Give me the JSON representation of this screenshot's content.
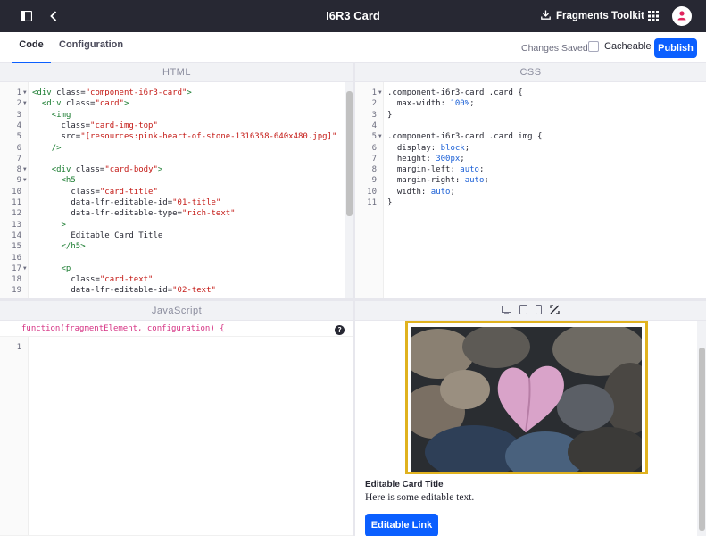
{
  "topbar": {
    "title": "I6R3 Card",
    "toolkit_label": "Fragments Toolkit"
  },
  "subbar": {
    "tabs": [
      {
        "label": "Code"
      },
      {
        "label": "Configuration"
      }
    ],
    "status": "Changes Saved",
    "cacheable_label": "Cacheable",
    "publish_label": "Publish"
  },
  "html_panel": {
    "header": "HTML",
    "lines": [
      {
        "n": "1",
        "fold": true,
        "code": "<div class=\"component-i6r3-card\">"
      },
      {
        "n": "2",
        "fold": true,
        "code": "  <div class=\"card\">"
      },
      {
        "n": "3",
        "fold": false,
        "code": "    <img"
      },
      {
        "n": "4",
        "fold": false,
        "code": "      class=\"card-img-top\""
      },
      {
        "n": "5",
        "fold": false,
        "code": "      src=\"[resources:pink-heart-of-stone-1316358-640x480.jpg]\""
      },
      {
        "n": "6",
        "fold": false,
        "code": "    />"
      },
      {
        "n": "7",
        "fold": false,
        "code": ""
      },
      {
        "n": "8",
        "fold": true,
        "code": "    <div class=\"card-body\">"
      },
      {
        "n": "9",
        "fold": true,
        "code": "      <h5"
      },
      {
        "n": "10",
        "fold": false,
        "code": "        class=\"card-title\""
      },
      {
        "n": "11",
        "fold": false,
        "code": "        data-lfr-editable-id=\"01-title\""
      },
      {
        "n": "12",
        "fold": false,
        "code": "        data-lfr-editable-type=\"rich-text\""
      },
      {
        "n": "13",
        "fold": false,
        "code": "      >"
      },
      {
        "n": "14",
        "fold": false,
        "code": "        Editable Card Title"
      },
      {
        "n": "15",
        "fold": false,
        "code": "      </h5>"
      },
      {
        "n": "16",
        "fold": false,
        "code": ""
      },
      {
        "n": "17",
        "fold": true,
        "code": "      <p"
      },
      {
        "n": "18",
        "fold": false,
        "code": "        class=\"card-text\""
      },
      {
        "n": "19",
        "fold": false,
        "code": "        data-lfr-editable-id=\"02-text\""
      }
    ]
  },
  "css_panel": {
    "header": "CSS",
    "lines": [
      {
        "n": "1",
        "fold": true,
        "code": ".component-i6r3-card .card {"
      },
      {
        "n": "2",
        "fold": false,
        "code": "  max-width: 100%;"
      },
      {
        "n": "3",
        "fold": false,
        "code": "}"
      },
      {
        "n": "4",
        "fold": false,
        "code": ""
      },
      {
        "n": "5",
        "fold": true,
        "code": ".component-i6r3-card .card img {"
      },
      {
        "n": "6",
        "fold": false,
        "code": "  display: block;"
      },
      {
        "n": "7",
        "fold": false,
        "code": "  height: 300px;"
      },
      {
        "n": "8",
        "fold": false,
        "code": "  margin-left: auto;"
      },
      {
        "n": "9",
        "fold": false,
        "code": "  margin-right: auto;"
      },
      {
        "n": "10",
        "fold": false,
        "code": "  width: auto;"
      },
      {
        "n": "11",
        "fold": false,
        "code": "}"
      }
    ]
  },
  "js_panel": {
    "header": "JavaScript",
    "signature": "function(fragmentElement, configuration) {",
    "line_number": "1",
    "closing": "}"
  },
  "preview": {
    "card_title": "Editable Card Title",
    "card_text": "Here is some editable text.",
    "link_label": "Editable Link"
  },
  "colors": {
    "accent": "#0b5fff",
    "topbar": "#272833",
    "selection_frame": "#e0b21f",
    "heart": "#d9a3c9"
  },
  "icons": {
    "sidebar_toggle": "sidebar-panel-icon",
    "back": "chevron-left-icon",
    "toolkit": "download-icon",
    "apps": "grid-icon",
    "user": "user-icon",
    "help": "question-circle-icon",
    "viewports": [
      "desktop-icon",
      "tablet-icon",
      "mobile-icon",
      "custom-size-icon"
    ]
  }
}
